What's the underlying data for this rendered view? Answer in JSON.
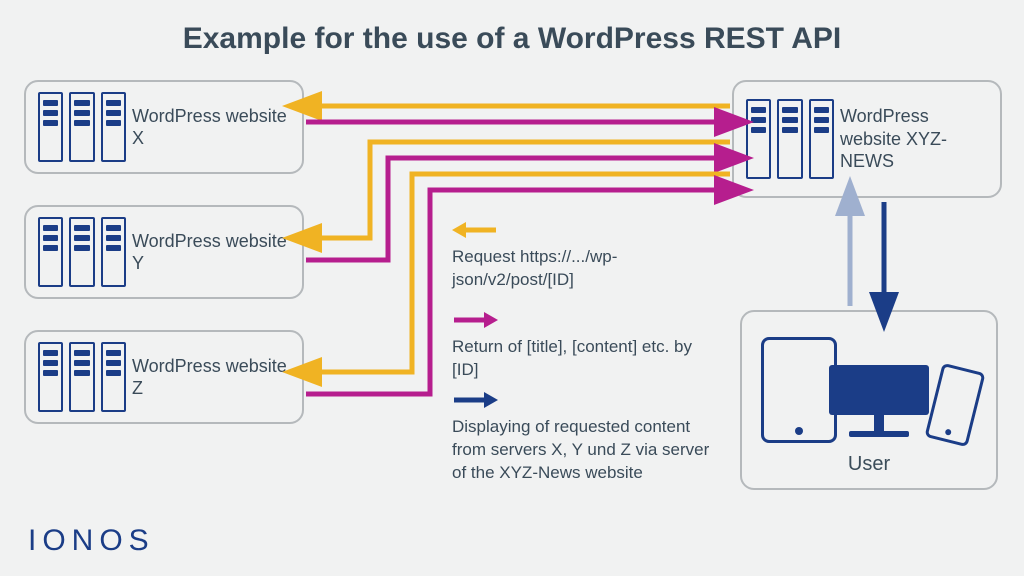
{
  "title": "Example for the use of a WordPress REST API",
  "servers": {
    "x": "WordPress website X",
    "y": "WordPress website Y",
    "z": "WordPress website Z",
    "news": "WordPress website XYZ-NEWS"
  },
  "user_label": "User",
  "legend": {
    "request": "Request https://.../wp-json/v2/post/[ID]",
    "return": "Return of [title], [content] etc. by [ID]",
    "display": "Displaying of requested content from servers X, Y und Z via server of the XYZ-News website"
  },
  "colors": {
    "request": "#f0b323",
    "return": "#b61e8e",
    "display": "#1b3d87",
    "display_light": "#9fb0cf"
  },
  "brand": "IONOS"
}
